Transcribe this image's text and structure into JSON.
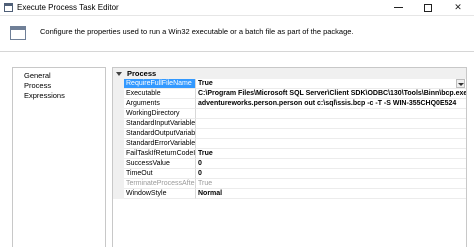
{
  "window": {
    "title": "Execute Process Task Editor",
    "icon": "window-icon"
  },
  "header": {
    "description": "Configure the properties used to run a Win32 executable or a batch file as part of the package."
  },
  "nav": {
    "items": [
      {
        "label": "General"
      },
      {
        "label": "Process"
      },
      {
        "label": "Expressions"
      }
    ]
  },
  "grid": {
    "category": "Process",
    "properties": [
      {
        "name": "RequireFullFileName",
        "value": "True",
        "selected": true,
        "dropdown": true
      },
      {
        "name": "Executable",
        "value": "C:\\Program Files\\Microsoft SQL Server\\Client SDK\\ODBC\\130\\Tools\\Binn\\bcp.exe"
      },
      {
        "name": "Arguments",
        "value": "adventureworks.person.person out c:\\sql\\ssis.bcp -c -T -S WIN-355CHQ0E524"
      },
      {
        "name": "WorkingDirectory",
        "value": ""
      },
      {
        "name": "StandardInputVariable",
        "value": ""
      },
      {
        "name": "StandardOutputVariable",
        "value": ""
      },
      {
        "name": "StandardErrorVariable",
        "value": ""
      },
      {
        "name": "FailTaskIfReturnCodeIsNot",
        "value": "True"
      },
      {
        "name": "SuccessValue",
        "value": "0"
      },
      {
        "name": "TimeOut",
        "value": "0"
      },
      {
        "name": "TerminateProcessAfterTimeOut",
        "value": "True",
        "disabled": true
      },
      {
        "name": "WindowStyle",
        "value": "Normal"
      }
    ]
  }
}
